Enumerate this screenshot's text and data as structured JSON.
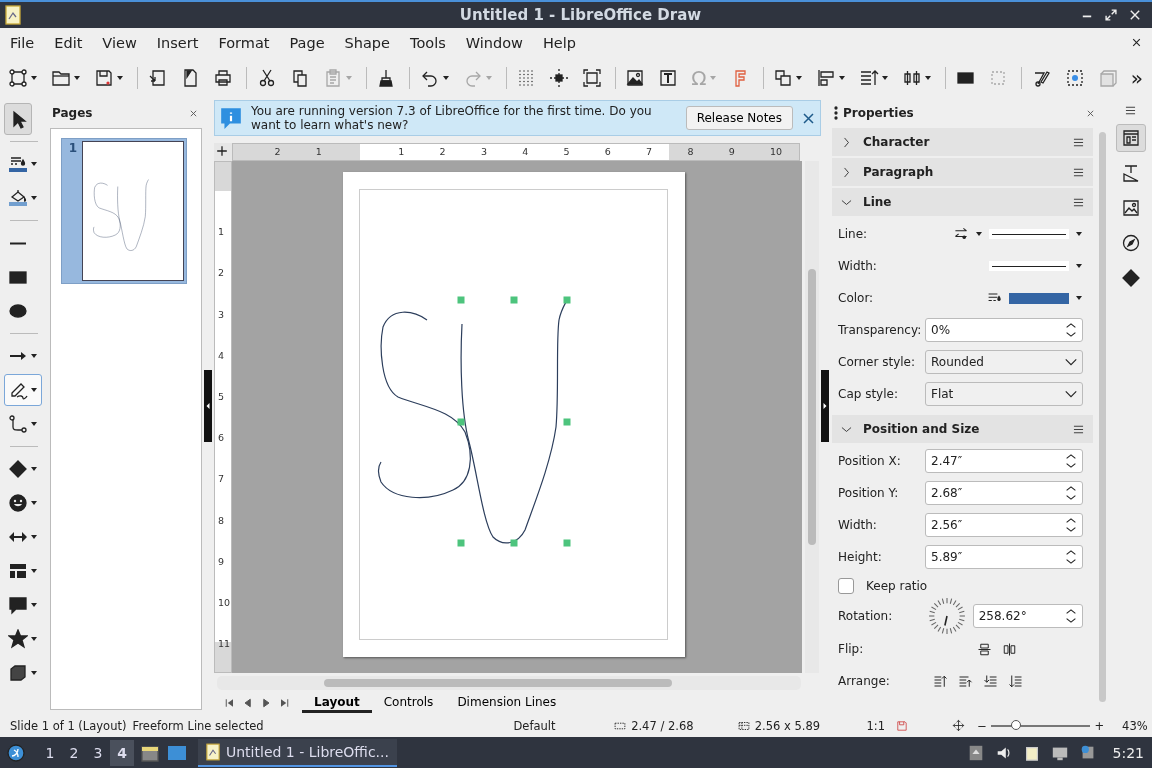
{
  "window": {
    "title": "Untitled 1 - LibreOffice Draw"
  },
  "menu": [
    "File",
    "Edit",
    "View",
    "Insert",
    "Format",
    "Page",
    "Shape",
    "Tools",
    "Window",
    "Help"
  ],
  "toolbar": [
    {
      "kind": "points",
      "disabled": false,
      "dropdown": true
    },
    {
      "kind": "open",
      "disabled": false,
      "dropdown": true
    },
    {
      "kind": "save",
      "disabled": false,
      "dropdown": true
    },
    {
      "kind": "separator"
    },
    {
      "kind": "export",
      "disabled": false,
      "dropdown": false
    },
    {
      "kind": "pdf",
      "disabled": false,
      "dropdown": false
    },
    {
      "kind": "print",
      "disabled": false,
      "dropdown": false
    },
    {
      "kind": "separator"
    },
    {
      "kind": "cut",
      "disabled": false,
      "dropdown": false
    },
    {
      "kind": "copy",
      "disabled": false,
      "dropdown": false
    },
    {
      "kind": "paste",
      "disabled": true,
      "dropdown": true
    },
    {
      "kind": "separator"
    },
    {
      "kind": "brush",
      "disabled": false,
      "dropdown": false
    },
    {
      "kind": "separator"
    },
    {
      "kind": "undo",
      "disabled": false,
      "dropdown": true
    },
    {
      "kind": "redo",
      "disabled": true,
      "dropdown": true
    },
    {
      "kind": "separator"
    },
    {
      "kind": "grid",
      "disabled": false,
      "dropdown": false
    },
    {
      "kind": "guides",
      "disabled": false,
      "dropdown": false
    },
    {
      "kind": "frame",
      "disabled": false,
      "dropdown": false
    },
    {
      "kind": "separator"
    },
    {
      "kind": "image",
      "disabled": false,
      "dropdown": false
    },
    {
      "kind": "textbox",
      "disabled": false,
      "dropdown": false
    },
    {
      "kind": "symbol",
      "label": "Ω",
      "disabled": true,
      "dropdown": true
    },
    {
      "kind": "fontwork",
      "disabled": false,
      "dropdown": false
    },
    {
      "kind": "separator"
    },
    {
      "kind": "transform",
      "disabled": false,
      "dropdown": true
    },
    {
      "kind": "align",
      "disabled": false,
      "dropdown": true
    },
    {
      "kind": "arrange",
      "disabled": false,
      "dropdown": true
    },
    {
      "kind": "distribute",
      "disabled": false,
      "dropdown": true
    },
    {
      "kind": "separator"
    },
    {
      "kind": "shadow",
      "disabled": false,
      "dropdown": false
    },
    {
      "kind": "crop",
      "disabled": true,
      "dropdown": false
    },
    {
      "kind": "separator"
    },
    {
      "kind": "editpoints",
      "disabled": false,
      "dropdown": false
    },
    {
      "kind": "glue",
      "disabled": false,
      "dropdown": false
    },
    {
      "kind": "cube",
      "disabled": true,
      "dropdown": false
    },
    {
      "kind": "more",
      "label": "»",
      "disabled": false,
      "dropdown": false
    }
  ],
  "tools": [
    {
      "kind": "select",
      "selected": true,
      "dropdown": false
    },
    {
      "kind": "separator"
    },
    {
      "kind": "linecolor",
      "selected": false,
      "dropdown": true
    },
    {
      "kind": "fillcolor",
      "selected": false,
      "dropdown": true
    },
    {
      "kind": "separator"
    },
    {
      "kind": "line",
      "selected": false,
      "dropdown": false
    },
    {
      "kind": "rect",
      "selected": false,
      "dropdown": false
    },
    {
      "kind": "ellipse",
      "selected": false,
      "dropdown": false
    },
    {
      "kind": "separator"
    },
    {
      "kind": "arrow",
      "selected": false,
      "dropdown": true
    },
    {
      "kind": "freeform",
      "selected": true,
      "dropdown": true
    },
    {
      "kind": "connector",
      "selected": false,
      "dropdown": true
    },
    {
      "kind": "separator"
    },
    {
      "kind": "diamond",
      "selected": false,
      "dropdown": true
    },
    {
      "kind": "smiley",
      "selected": false,
      "dropdown": true
    },
    {
      "kind": "doublearrow",
      "selected": false,
      "dropdown": true
    },
    {
      "kind": "flowchart",
      "selected": false,
      "dropdown": true
    },
    {
      "kind": "callout",
      "selected": false,
      "dropdown": true
    },
    {
      "kind": "star",
      "selected": false,
      "dropdown": true
    },
    {
      "kind": "cube",
      "selected": false,
      "dropdown": true
    }
  ],
  "pages_pane": {
    "title": "Pages",
    "pages": [
      {
        "number": "1",
        "selected": true
      }
    ]
  },
  "infobar": {
    "message": "You are running version 7.3 of LibreOffice for the first time. Do you want to learn what's new?",
    "button": "Release Notes"
  },
  "ruler_h": [
    "2",
    "1",
    "1",
    "2",
    "3",
    "4",
    "5",
    "6",
    "7",
    "8",
    "9",
    "10"
  ],
  "ruler_v": [
    "1",
    "2",
    "3",
    "4",
    "5",
    "6",
    "7",
    "8",
    "9",
    "10",
    "11"
  ],
  "layer_tabs": [
    {
      "label": "Layout",
      "selected": true
    },
    {
      "label": "Controls",
      "selected": false
    },
    {
      "label": "Dimension Lines",
      "selected": false
    }
  ],
  "properties": {
    "title": "Properties",
    "sections": [
      {
        "title": "Character",
        "expanded": false
      },
      {
        "title": "Paragraph",
        "expanded": false
      },
      {
        "title": "Line",
        "expanded": true,
        "rows": [
          {
            "kind": "linestyle",
            "label": "Line:"
          },
          {
            "kind": "linewidth",
            "label": "Width:"
          },
          {
            "kind": "color",
            "label": "Color:",
            "color": "#3465a4"
          },
          {
            "kind": "spin",
            "label": "Transparency:",
            "value": "0%"
          },
          {
            "kind": "select",
            "label": "Corner style:",
            "value": "Rounded"
          },
          {
            "kind": "select",
            "label": "Cap style:",
            "value": "Flat"
          }
        ]
      },
      {
        "title": "Position and Size",
        "expanded": true,
        "rows": [
          {
            "kind": "spin",
            "label": "Position X:",
            "value": "2.47″"
          },
          {
            "kind": "spin",
            "label": "Position Y:",
            "value": "2.68″"
          },
          {
            "kind": "spin",
            "label": "Width:",
            "value": "2.56″"
          },
          {
            "kind": "spin",
            "label": "Height:",
            "value": "5.89″"
          },
          {
            "kind": "checkbox",
            "label": "Keep ratio",
            "checked": false
          },
          {
            "kind": "rotation",
            "label": "Rotation:",
            "value": "258.62°"
          },
          {
            "kind": "flip",
            "label": "Flip:"
          },
          {
            "kind": "arrange",
            "label": "Arrange:"
          }
        ]
      }
    ]
  },
  "status_bar": {
    "slide": "Slide 1 of 1 (Layout)",
    "selection": "Freeform Line selected",
    "layout": "Default",
    "position": "2.47 / 2.68",
    "size": "2.56 x 5.89",
    "scale": "1:1",
    "zoom_out": "−",
    "zoom_in": "+",
    "zoom_slider": {
      "level": 0.25
    },
    "zoom": "43%"
  },
  "taskbar": {
    "workspaces": [
      {
        "label": "1",
        "selected": false
      },
      {
        "label": "2",
        "selected": false
      },
      {
        "label": "3",
        "selected": false
      },
      {
        "label": "4",
        "selected": true
      }
    ],
    "task": "Untitled 1 - LibreOffic...",
    "clock": "5:21"
  }
}
